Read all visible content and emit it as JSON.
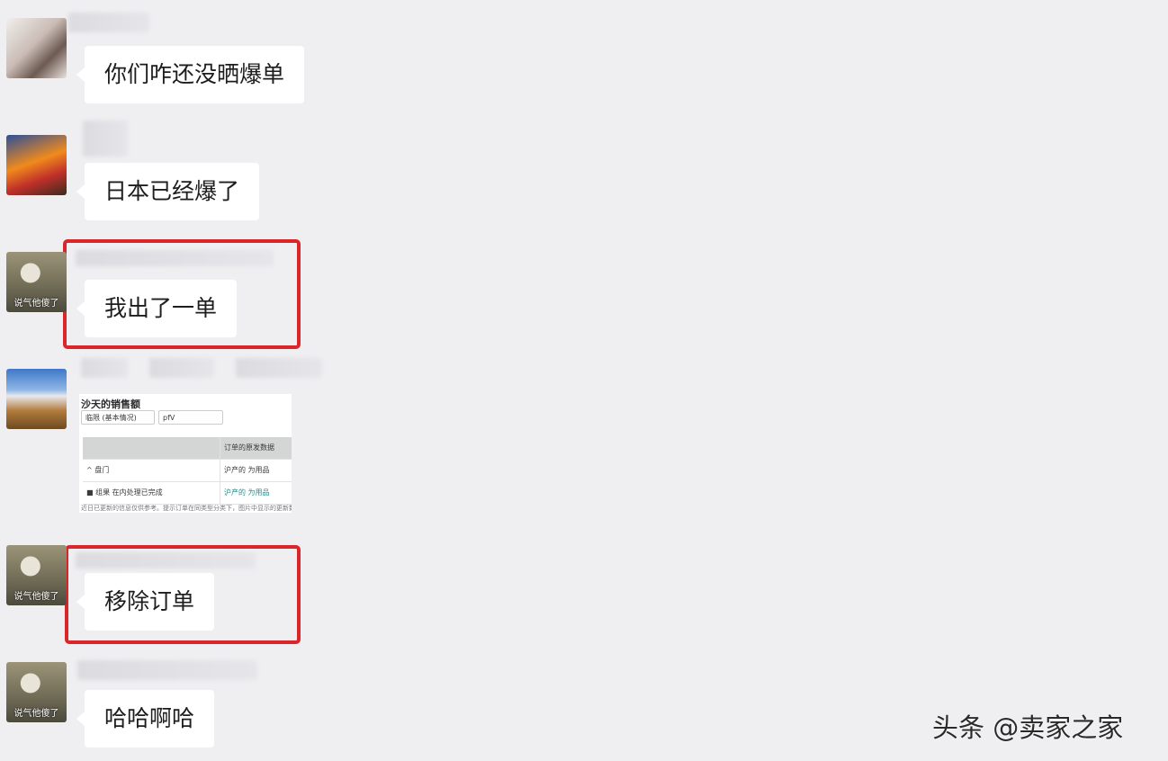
{
  "messages": [
    {
      "avatar": "cat-photo-avatar",
      "text": "你们咋还没晒爆单"
    },
    {
      "avatar": "anime-avatar",
      "text": "日本已经爆了"
    },
    {
      "avatar": "duck-avatar",
      "avatar_caption": "说气他傻了",
      "text": "我出了一单",
      "highlighted": true
    },
    {
      "avatar": "mountain-avatar",
      "image": {
        "title": "沙天的销售额",
        "select1": "临限 (基本情况)",
        "select2": "pfV",
        "header_col2": "订单的原发数据",
        "row1_col1": "^ 盘门",
        "row1_col2": "沪产的 为用品",
        "row2_col1": "■ 组果 在内处理已完成",
        "row2_col2": "沪产的 为用品",
        "footer": "近日已更新的信息仅供参考。提示订单在同类型分类下，图片中显示的更新数据"
      }
    },
    {
      "avatar": "duck-avatar",
      "avatar_caption": "说气他傻了",
      "text": "移除订单",
      "highlighted": true
    },
    {
      "avatar": "duck-avatar",
      "avatar_caption": "说气他傻了",
      "text": "哈哈啊哈"
    }
  ],
  "watermark": "头条 @卖家之家",
  "colors": {
    "background": "#efeff1",
    "bubble": "#ffffff",
    "highlight": "#d9262b"
  }
}
